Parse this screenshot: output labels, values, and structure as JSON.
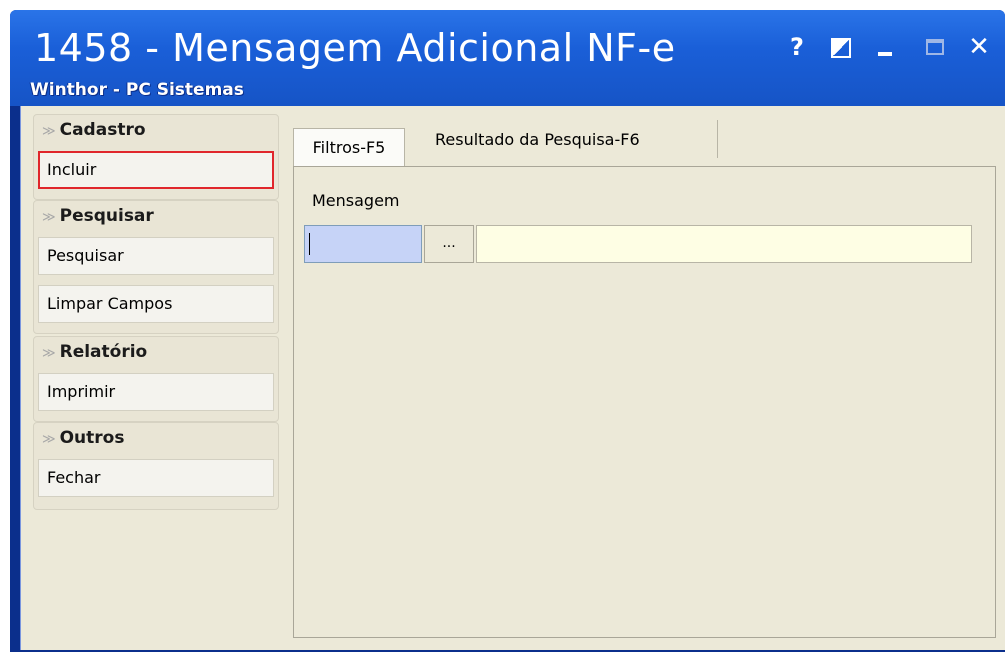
{
  "window": {
    "title": "1458 - Mensagem Adicional NF-e",
    "subtitle": "Winthor - PC Sistemas",
    "buttons": {
      "help": "?",
      "close": "✕"
    }
  },
  "sidebar": {
    "groups": [
      {
        "label": "Cadastro",
        "items": [
          {
            "label": "Incluir",
            "selected": true
          }
        ]
      },
      {
        "label": "Pesquisar",
        "items": [
          {
            "label": "Pesquisar"
          },
          {
            "label": "Limpar Campos"
          }
        ]
      },
      {
        "label": "Relatório",
        "items": [
          {
            "label": "Imprimir"
          }
        ]
      },
      {
        "label": "Outros",
        "items": [
          {
            "label": "Fechar"
          }
        ]
      }
    ],
    "collapse_icon": "double-chevron-down-icon"
  },
  "tabs": [
    {
      "label": "Filtros-F5",
      "active": true
    },
    {
      "label": "Resultado da Pesquisa-F6",
      "active": false
    }
  ],
  "filters": {
    "mensagem_label": "Mensagem",
    "code_value": "",
    "lookup_button": "...",
    "description_value": ""
  },
  "colors": {
    "titlebar": "#1a5fd8",
    "client_bg": "#ece9d8",
    "selected_border": "#e0262b",
    "code_input_bg": "#c6d3f7",
    "description_input_bg": "#fefee4"
  }
}
